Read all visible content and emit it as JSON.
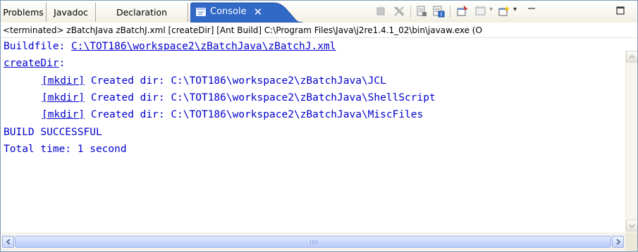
{
  "tabs": [
    {
      "label": "Problems"
    },
    {
      "label": "Javadoc"
    },
    {
      "label": "Declaration"
    },
    {
      "label": "Console",
      "active": true
    }
  ],
  "toolbar_icons": [
    "terminate-icon",
    "remove-launches-icon",
    "clear-console-icon",
    "scroll-lock-icon",
    "pin-console-icon",
    "display-console-icon",
    "open-console-icon",
    "minimize-icon",
    "maximize-icon"
  ],
  "status_line": "<terminated> zBatchJava zBatchJ.xml [createDir] [Ant Build] C:\\Program Files\\Java\\j2re1.4.1_02\\bin\\javaw.exe (O",
  "console": {
    "buildfile_label": "Buildfile: ",
    "buildfile_path": "C:\\TOT186\\workspace2\\zBatchJava\\zBatchJ.xml",
    "target": "createDir",
    "target_suffix": ":",
    "mkdir_lines": [
      {
        "task": "[mkdir]",
        "text": " Created dir: C:\\TOT186\\workspace2\\zBatchJava\\JCL"
      },
      {
        "task": "[mkdir]",
        "text": " Created dir: C:\\TOT186\\workspace2\\zBatchJava\\ShellScript"
      },
      {
        "task": "[mkdir]",
        "text": " Created dir: C:\\TOT186\\workspace2\\zBatchJava\\MiscFiles"
      }
    ],
    "result": "BUILD SUCCESSFUL",
    "total_time": "Total time: 1 second"
  },
  "colors": {
    "console_text": "#0000cc",
    "active_tab": "#3169c6",
    "frame_border": "#7f9db9"
  }
}
